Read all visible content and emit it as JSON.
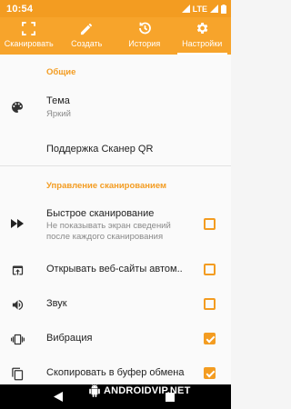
{
  "status_bar": {
    "time": "10:54",
    "network": "LTE",
    "accent": "#f39c21"
  },
  "tabs": [
    {
      "label": "Сканировать",
      "icon": "scan-frame-icon"
    },
    {
      "label": "Создать",
      "icon": "pencil-icon"
    },
    {
      "label": "История",
      "icon": "history-icon"
    },
    {
      "label": "Настройки",
      "icon": "gear-icon",
      "active": true
    }
  ],
  "sections": {
    "general": "Общие",
    "scan_control": "Управление сканированием"
  },
  "settings": {
    "theme": {
      "title": "Тема",
      "value": "Яркий",
      "icon": "palette-icon"
    },
    "support": {
      "title": "Поддержка Сканер QR"
    },
    "fast_scan": {
      "title": "Быстрое сканирование",
      "subtitle": "Не показывать экран сведений после каждого сканирования",
      "icon": "fast-forward-icon",
      "checked": false
    },
    "open_sites": {
      "title": "Открывать веб-сайты автом..",
      "icon": "open-in-browser-icon",
      "checked": false
    },
    "sound": {
      "title": "Звук",
      "icon": "speaker-icon",
      "checked": false
    },
    "vibration": {
      "title": "Вибрация",
      "icon": "vibration-icon",
      "checked": true
    },
    "copy_clipboard": {
      "title": "Скопировать в буфер обмена",
      "icon": "copy-icon",
      "checked": true
    }
  },
  "watermark": {
    "text": "ANDROIDVIP.NET"
  }
}
